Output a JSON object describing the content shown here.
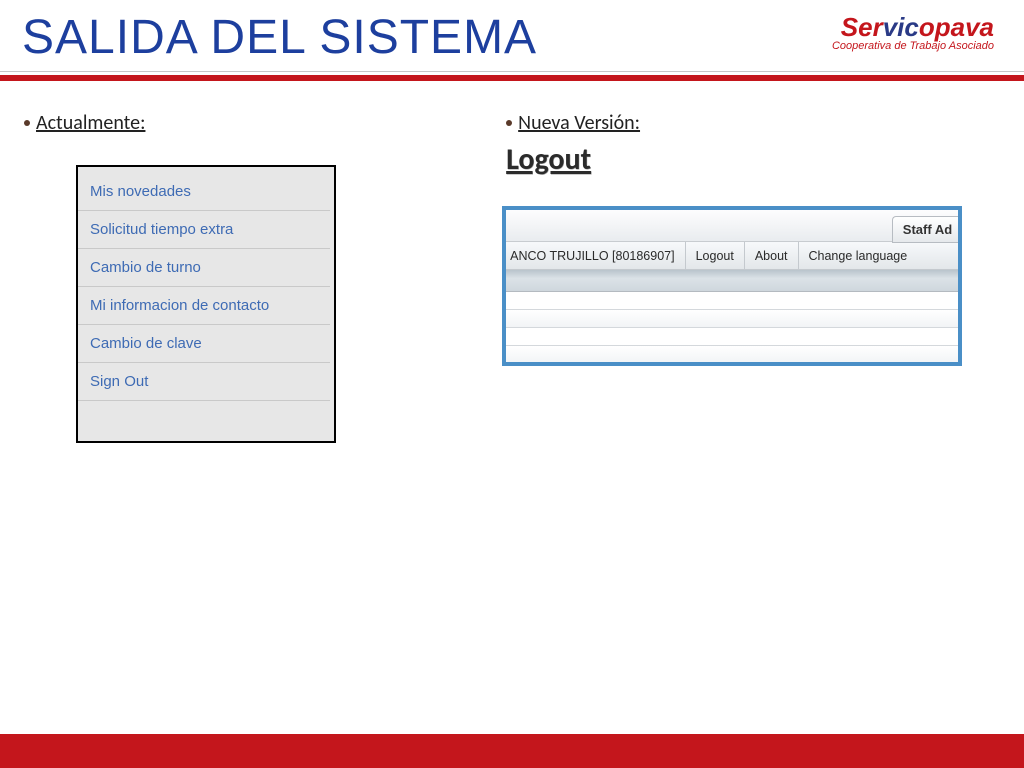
{
  "header": {
    "title": "SALIDA DEL SISTEMA",
    "logo": {
      "text": "Servicopava",
      "tagline": "Cooperativa de Trabajo Asociado"
    }
  },
  "left": {
    "label": "Actualmente:",
    "menu_items": [
      "Mis novedades",
      "Solicitud tiempo extra",
      "Cambio de turno",
      "Mi informacion de contacto",
      "Cambio de clave",
      "Sign Out"
    ]
  },
  "right": {
    "label": "Nueva Versión:",
    "heading": "Logout",
    "panel": {
      "tab": "Staff Ad",
      "user": "ANCO TRUJILLO [80186907]",
      "links": {
        "logout": "Logout",
        "about": "About",
        "change_language": "Change language"
      }
    }
  }
}
